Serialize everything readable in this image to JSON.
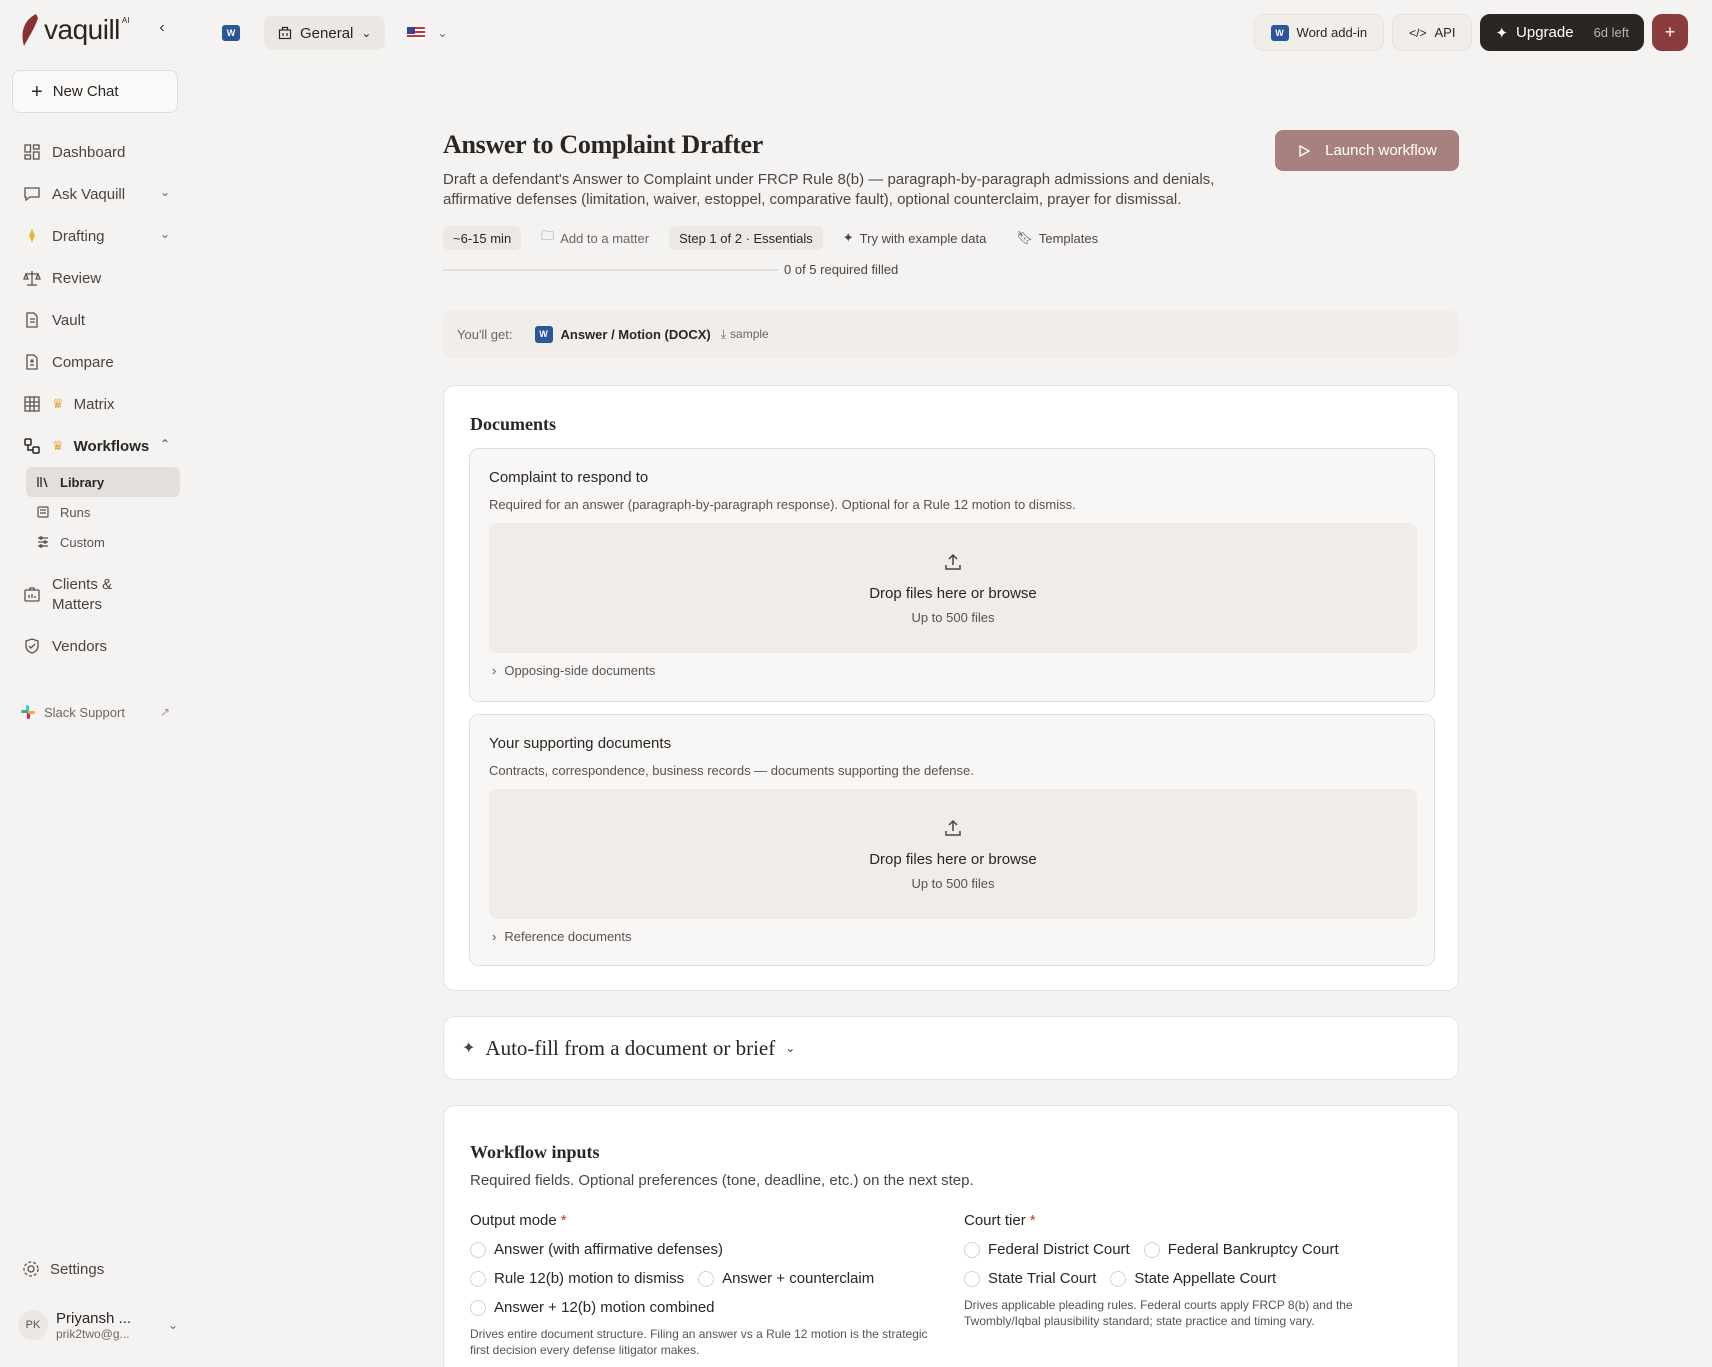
{
  "app": {
    "logo_text": "vaquill",
    "logo_sup": "AI"
  },
  "sidebar": {
    "new_chat": "New Chat",
    "items": [
      {
        "label": "Dashboard",
        "icon": "dashboard-icon"
      },
      {
        "label": "Ask Vaquill",
        "icon": "chat-icon"
      },
      {
        "label": "Drafting",
        "icon": "pen-icon"
      },
      {
        "label": "Review",
        "icon": "scale-icon"
      },
      {
        "label": "Vault",
        "icon": "file-icon"
      },
      {
        "label": "Compare",
        "icon": "compare-icon"
      },
      {
        "label": "Matrix",
        "icon": "grid-icon"
      },
      {
        "label": "Workflows",
        "icon": "workflow-icon"
      }
    ],
    "workflows_sub": [
      {
        "label": "Library",
        "icon": "library-icon"
      },
      {
        "label": "Runs",
        "icon": "runs-icon"
      },
      {
        "label": "Custom",
        "icon": "sliders-icon"
      }
    ],
    "clients": "Clients &\nMatters",
    "vendors": "Vendors",
    "slack": "Slack Support",
    "settings": "Settings",
    "user": {
      "initials": "PK",
      "name": "Priyansh ...",
      "email": "prik2two@g..."
    }
  },
  "topbar": {
    "workspace": "General",
    "word_addin": "Word add-in",
    "api": "API",
    "upgrade": "Upgrade",
    "upgrade_sub": "6d left",
    "plus": "+"
  },
  "page": {
    "title": "Answer to Complaint Drafter",
    "description": "Draft a defendant's Answer to Complaint under FRCP Rule 8(b) — paragraph-by-paragraph admissions and denials, affirmative defenses (limitation, waiver, estoppel, comparative fault), optional counterclaim, prayer for dismissal.",
    "launch": "Launch workflow",
    "chips": {
      "time": "~6-15 min",
      "matter": "Add to a matter",
      "step": "Step 1 of 2 · Essentials",
      "example": "Try with example data",
      "templates": "Templates"
    },
    "progress_text": "0 of 5 required filled",
    "progress_fraction": 0.0
  },
  "youget": {
    "label": "You'll get:",
    "doc": "Answer / Motion (DOCX)",
    "sample": "sample"
  },
  "documents": {
    "title": "Documents",
    "sections": [
      {
        "title": "Complaint to respond to",
        "desc": "Required for an answer (paragraph-by-paragraph response). Optional for a Rule 12 motion to dismiss.",
        "drop_title": "Drop files here or browse",
        "drop_sub": "Up to 500 files",
        "footer": "Opposing-side documents"
      },
      {
        "title": "Your supporting documents",
        "desc": "Contracts, correspondence, business records — documents supporting the defense.",
        "drop_title": "Drop files here or browse",
        "drop_sub": "Up to 500 files",
        "footer": "Reference documents"
      }
    ]
  },
  "autofill": {
    "label": "Auto-fill from a document or brief"
  },
  "inputs": {
    "title": "Workflow inputs",
    "desc": "Required fields. Optional preferences (tone, deadline, etc.) on the next step.",
    "output_mode": {
      "label": "Output mode",
      "required": "*",
      "options": [
        "Answer (with affirmative defenses)",
        "Rule 12(b) motion to dismiss",
        "Answer + counterclaim",
        "Answer + 12(b) motion combined"
      ],
      "help": "Drives entire document structure. Filing an answer vs a Rule 12 motion is the strategic first decision every defense litigator makes."
    },
    "court_tier": {
      "label": "Court tier",
      "required": "*",
      "options": [
        "Federal District Court",
        "Federal Bankruptcy Court",
        "State Trial Court",
        "State Appellate Court"
      ],
      "help": "Drives applicable pleading rules. Federal courts apply FRCP 8(b) and the Twombly/Iqbal plausibility standard; state practice and timing vary."
    }
  }
}
